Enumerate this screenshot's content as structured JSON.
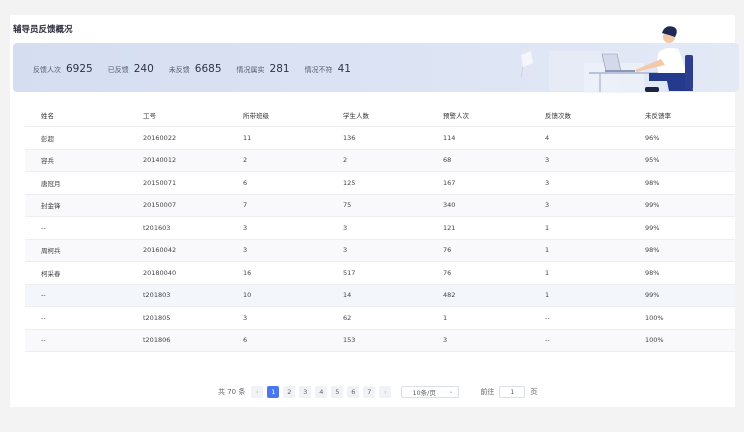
{
  "page": {
    "title": "辅导员反馈概况"
  },
  "stats": [
    {
      "label": "反馈人次",
      "value": "6925"
    },
    {
      "label": "已反馈",
      "value": "240"
    },
    {
      "label": "未反馈",
      "value": "6685"
    },
    {
      "label": "情况属实",
      "value": "281"
    },
    {
      "label": "情况不符",
      "value": "41"
    }
  ],
  "table": {
    "headers": [
      "姓名",
      "工号",
      "所带班级",
      "学生人数",
      "预警人次",
      "反馈次数",
      "未反馈率"
    ],
    "rows": [
      [
        "彭超",
        "20160022",
        "11",
        "136",
        "114",
        "4",
        "96%"
      ],
      [
        "容兵",
        "20140012",
        "2",
        "2",
        "68",
        "3",
        "95%"
      ],
      [
        "唐冠月",
        "20150071",
        "6",
        "125",
        "167",
        "3",
        "98%"
      ],
      [
        "封金锋",
        "20150007",
        "7",
        "75",
        "340",
        "3",
        "99%"
      ],
      [
        "--",
        "t201603",
        "3",
        "3",
        "121",
        "1",
        "99%"
      ],
      [
        "周柯兵",
        "20160042",
        "3",
        "3",
        "76",
        "1",
        "98%"
      ],
      [
        "柯采春",
        "20180040",
        "16",
        "517",
        "76",
        "1",
        "98%"
      ],
      [
        "--",
        "t201803",
        "10",
        "14",
        "482",
        "1",
        "99%"
      ],
      [
        "--",
        "t201805",
        "3",
        "62",
        "1",
        "--",
        "100%"
      ],
      [
        "--",
        "t201806",
        "6",
        "153",
        "3",
        "--",
        "100%"
      ]
    ]
  },
  "pagination": {
    "total": "共 70 条",
    "prev": "‹",
    "next": "›",
    "pages": [
      "1",
      "2",
      "3",
      "4",
      "5",
      "6",
      "7"
    ],
    "current": "1",
    "page_size": "10条/页",
    "goto_label": "前往",
    "goto_value": "1",
    "goto_suffix": "页"
  },
  "colors": {
    "accent": "#4a76f0",
    "banner": "#d9e0f2"
  }
}
